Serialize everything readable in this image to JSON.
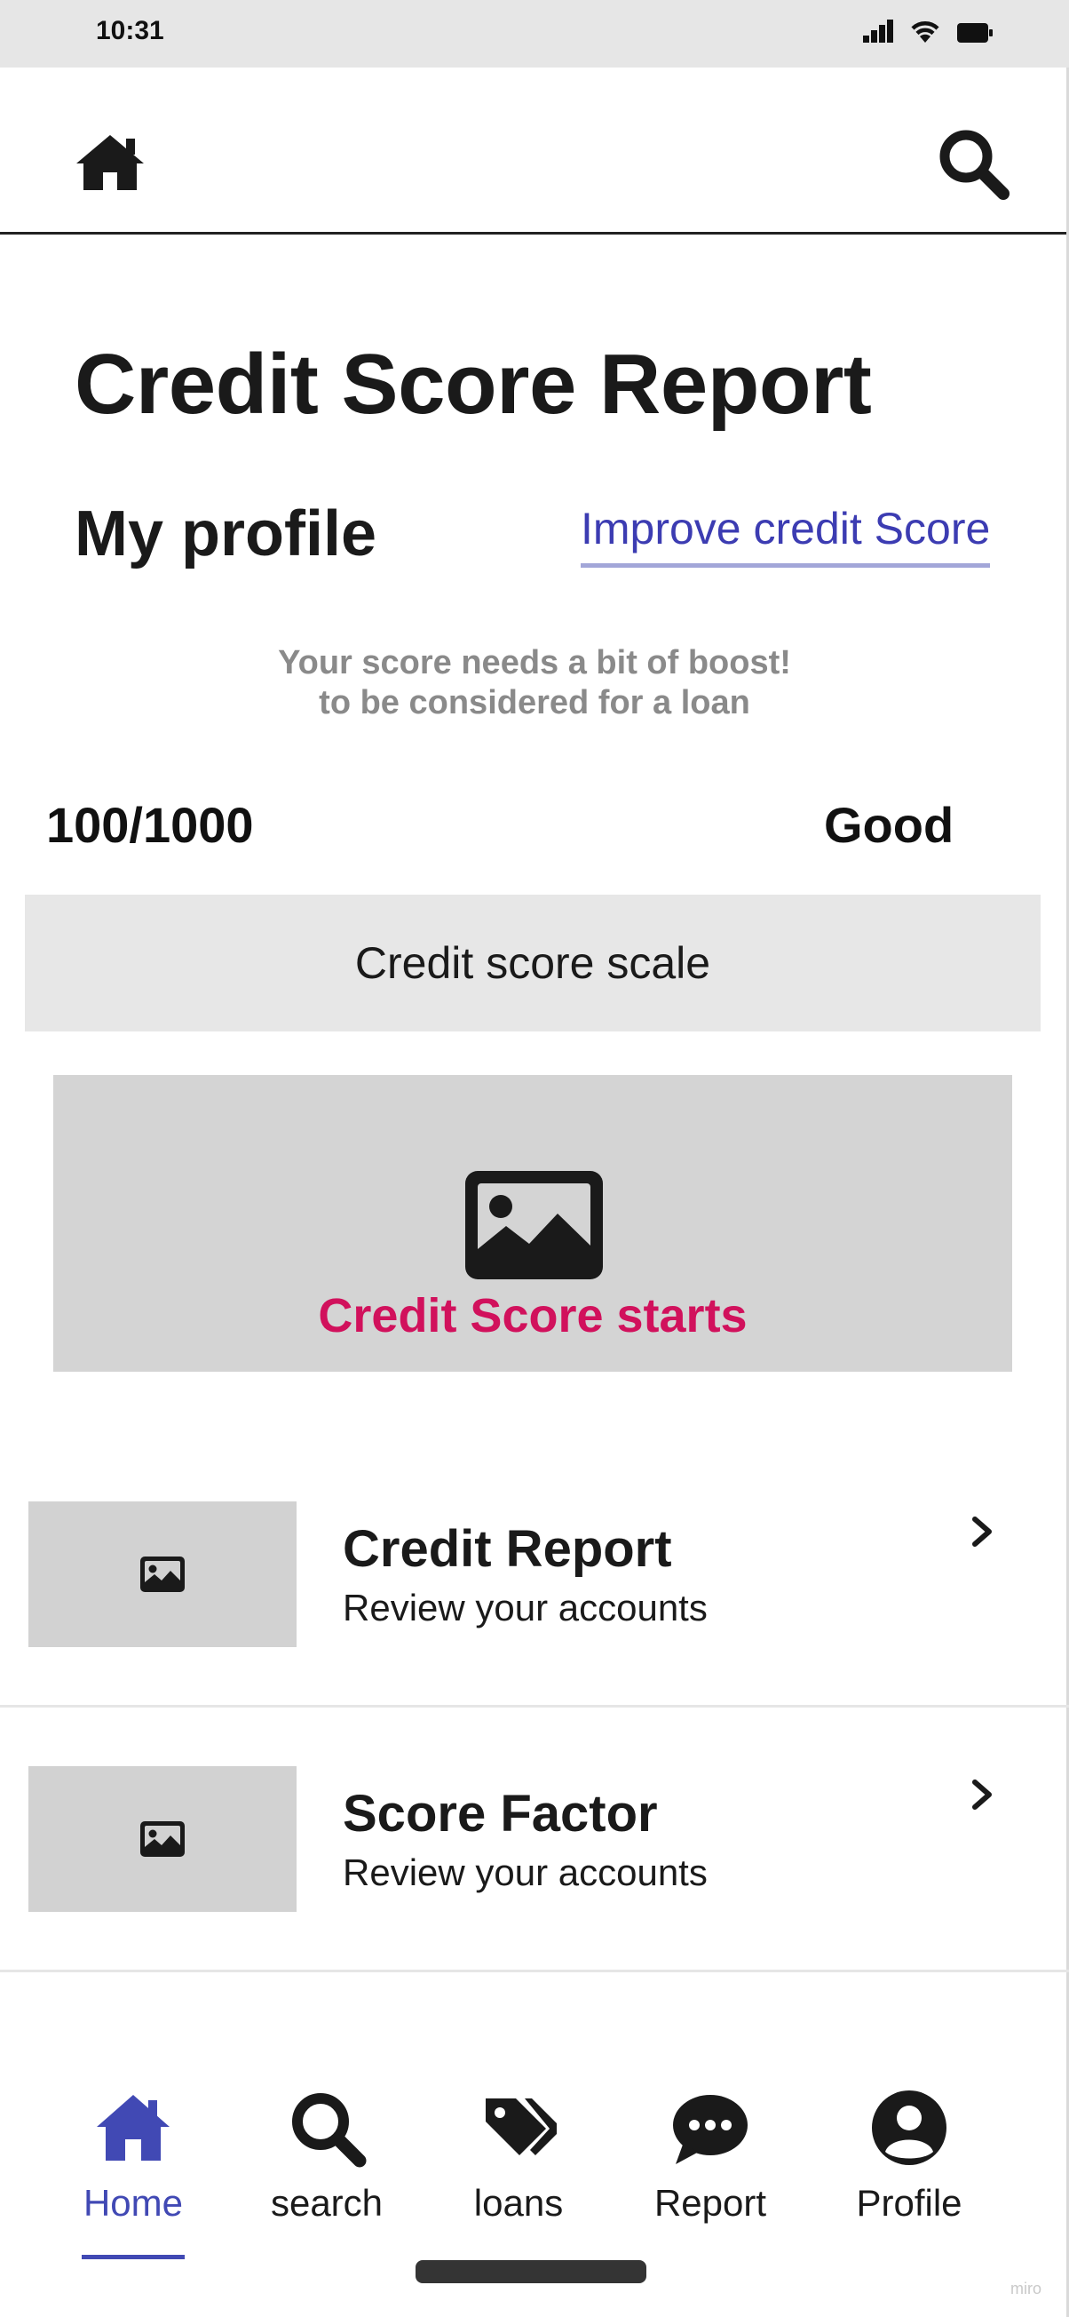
{
  "status_bar": {
    "time": "10:31"
  },
  "page": {
    "title": "Credit Score Report",
    "section_title": "My profile",
    "improve_link": "Improve credit Score",
    "boost_line1": "Your score needs a bit of boost!",
    "boost_line2": "to be considered for a loan",
    "score": "100/1000",
    "rating": "Good",
    "scale_label": "Credit score scale",
    "hero_label": "Credit Score starts"
  },
  "list": [
    {
      "title": "Credit Report",
      "subtitle": "Review your accounts"
    },
    {
      "title": "Score Factor",
      "subtitle": "Review your accounts"
    }
  ],
  "nav": {
    "items": [
      {
        "label": "Home",
        "icon": "home-icon",
        "active": true
      },
      {
        "label": "search",
        "icon": "search-icon",
        "active": false
      },
      {
        "label": "loans",
        "icon": "tags-icon",
        "active": false
      },
      {
        "label": "Report",
        "icon": "chat-bubble-icon",
        "active": false
      },
      {
        "label": "Profile",
        "icon": "user-circle-icon",
        "active": false
      }
    ]
  },
  "watermark": "miro",
  "colors": {
    "accent": "#4149b4",
    "link": "#3c3cb2",
    "hero_label": "#d1115c",
    "placeholder": "#d4d4d4"
  }
}
